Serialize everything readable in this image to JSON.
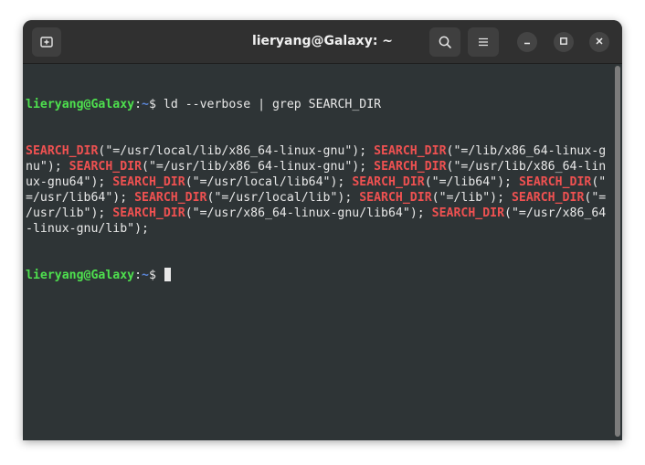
{
  "window": {
    "title": "lieryang@Galaxy: ~"
  },
  "prompt": {
    "user_host": "lieryang@Galaxy",
    "separator": ":",
    "path": "~",
    "symbol": "$ "
  },
  "command": "ld --verbose | grep SEARCH_DIR",
  "output_lines": [
    [
      {
        "t": "SEARCH_DIR",
        "hl": true
      },
      {
        "t": "(\"=/usr/local/lib/x86_64-linux-gnu\"); "
      },
      {
        "t": "SEARCH_DIR",
        "hl": true
      },
      {
        "t": "(\"=/lib/x86_64-linux-g"
      }
    ],
    [
      {
        "t": "nu\"); "
      },
      {
        "t": "SEARCH_DIR",
        "hl": true
      },
      {
        "t": "(\"=/usr/lib/x86_64-linux-gnu\"); "
      },
      {
        "t": "SEARCH_DIR",
        "hl": true
      },
      {
        "t": "(\"=/usr/lib/x86_64-lin"
      }
    ],
    [
      {
        "t": "ux-gnu64\"); "
      },
      {
        "t": "SEARCH_DIR",
        "hl": true
      },
      {
        "t": "(\"=/usr/local/lib64\"); "
      },
      {
        "t": "SEARCH_DIR",
        "hl": true
      },
      {
        "t": "(\"=/lib64\"); "
      },
      {
        "t": "SEARCH_DIR",
        "hl": true
      },
      {
        "t": "(\""
      }
    ],
    [
      {
        "t": "=/usr/lib64\"); "
      },
      {
        "t": "SEARCH_DIR",
        "hl": true
      },
      {
        "t": "(\"=/usr/local/lib\"); "
      },
      {
        "t": "SEARCH_DIR",
        "hl": true
      },
      {
        "t": "(\"=/lib\"); "
      },
      {
        "t": "SEARCH_DIR",
        "hl": true
      },
      {
        "t": "(\"="
      }
    ],
    [
      {
        "t": "/usr/lib\"); "
      },
      {
        "t": "SEARCH_DIR",
        "hl": true
      },
      {
        "t": "(\"=/usr/x86_64-linux-gnu/lib64\"); "
      },
      {
        "t": "SEARCH_DIR",
        "hl": true
      },
      {
        "t": "(\"=/usr/x86_64"
      }
    ],
    [
      {
        "t": "-linux-gnu/lib\");"
      }
    ]
  ],
  "colors": {
    "prompt_user": "#4ee04e",
    "prompt_path": "#5b86d8",
    "match": "#ef5151",
    "terminal_bg": "#2e3436",
    "titlebar_bg": "#303030"
  },
  "icons": {
    "new_tab": "new-tab-icon",
    "search": "search-icon",
    "menu": "hamburger-menu-icon",
    "minimize": "minimize-icon",
    "maximize": "maximize-icon",
    "close": "close-icon"
  }
}
